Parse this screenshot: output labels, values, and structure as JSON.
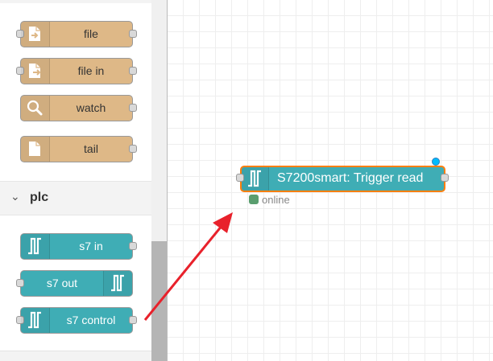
{
  "palette": {
    "category": {
      "chevron": "⌄",
      "label": "plc"
    },
    "nodes_storage": [
      {
        "label": "file",
        "icon": "file-out-icon"
      },
      {
        "label": "file in",
        "icon": "file-in-icon"
      },
      {
        "label": "watch",
        "icon": "magnifier-icon"
      },
      {
        "label": "tail",
        "icon": "file-icon"
      }
    ],
    "nodes_plc": [
      {
        "label": "s7 in",
        "icon": "s7-pulse-icon"
      },
      {
        "label": "s7 out",
        "icon": "s7-pulse-icon"
      },
      {
        "label": "s7 control",
        "icon": "s7-pulse-icon"
      }
    ]
  },
  "workspace": {
    "node": {
      "label": "S7200smart: Trigger read",
      "icon": "s7-pulse-icon",
      "status_text": "online"
    }
  },
  "colors": {
    "storage_node": "#deb887",
    "plc_node": "#3fadb5",
    "selection_outline": "#ff7f0e",
    "changed_indicator": "#00bcff",
    "status_connected": "#5a9e6f",
    "annotation_arrow": "#e8212b"
  }
}
